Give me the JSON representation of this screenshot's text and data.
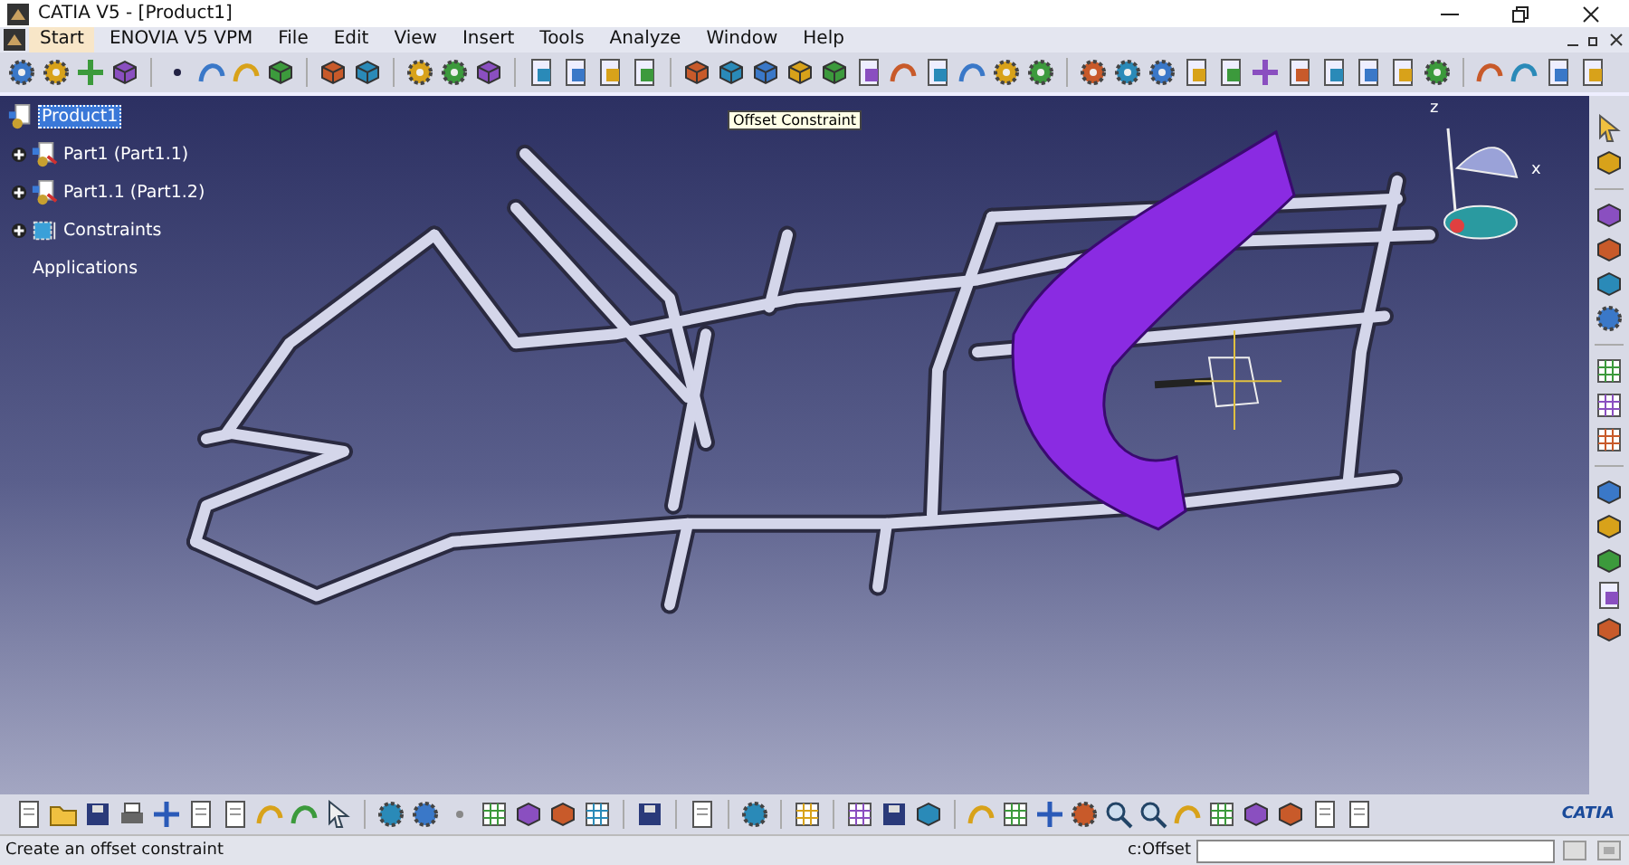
{
  "window": {
    "title": "CATIA V5 - [Product1]"
  },
  "menu": [
    {
      "label": "Start",
      "selected": true
    },
    {
      "label": "ENOVIA V5 VPM",
      "selected": false
    },
    {
      "label": "File",
      "selected": false
    },
    {
      "label": "Edit",
      "selected": false
    },
    {
      "label": "View",
      "selected": false
    },
    {
      "label": "Insert",
      "selected": false
    },
    {
      "label": "Tools",
      "selected": false
    },
    {
      "label": "Analyze",
      "selected": false
    },
    {
      "label": "Window",
      "selected": false
    },
    {
      "label": "Help",
      "selected": false
    }
  ],
  "tooltip": "Offset Constraint",
  "tree": {
    "root": {
      "label": "Product1",
      "selected": true
    },
    "children": [
      {
        "label": "Part1 (Part1.1)",
        "kind": "part",
        "expanded": false
      },
      {
        "label": "Part1.1 (Part1.2)",
        "kind": "part",
        "expanded": false
      },
      {
        "label": "Constraints",
        "kind": "constraints",
        "expanded": false
      },
      {
        "label": "Applications",
        "kind": "leaf"
      }
    ]
  },
  "compass_labels": [
    "z",
    "x"
  ],
  "logo": "CATIA",
  "status_bar": {
    "message": "Create an offset constraint",
    "command_label": "c:Offset"
  }
}
